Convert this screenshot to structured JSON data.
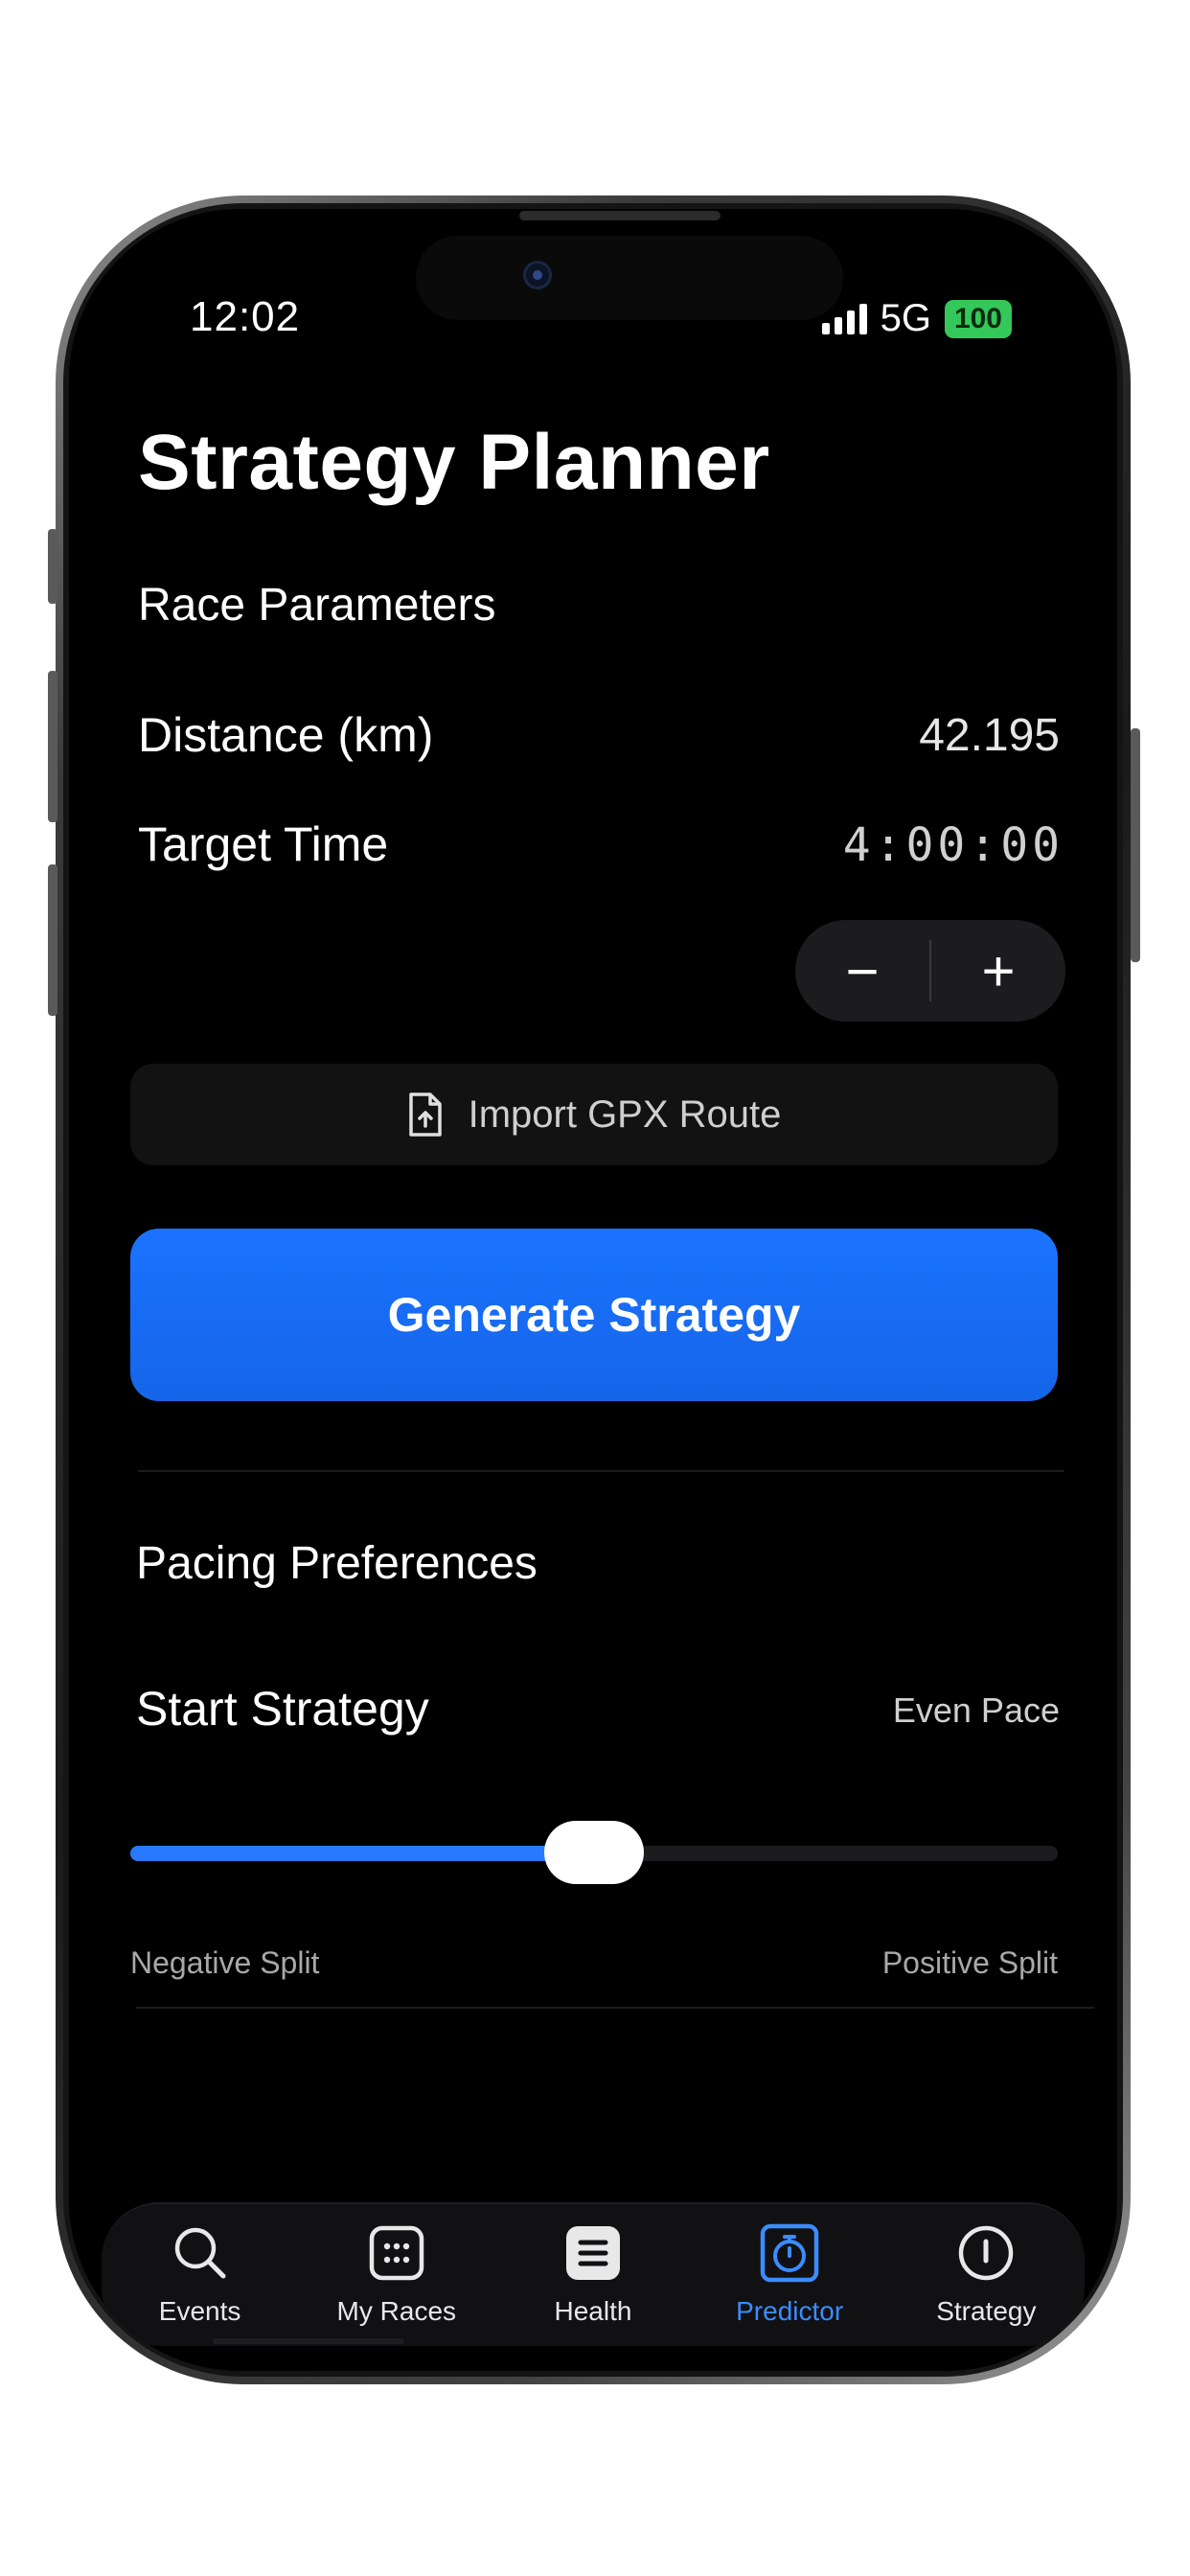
{
  "status_bar": {
    "time": "12:02",
    "network": "5G",
    "battery": "100"
  },
  "header": {
    "title": "Strategy Planner"
  },
  "race_parameters": {
    "section_title": "Race Parameters",
    "distance_label": "Distance (km)",
    "distance_value": "42.195",
    "target_time_label": "Target Time",
    "target_time_value": "4:00:00",
    "stepper_minus": "−",
    "stepper_plus": "+"
  },
  "import_button": {
    "label": "Import GPX Route",
    "icon": "file-upload-icon"
  },
  "generate_button": {
    "label": "Generate Strategy"
  },
  "pacing_preferences": {
    "section_title": "Pacing Preferences",
    "start_strategy_label": "Start Strategy",
    "start_strategy_value": "Even Pace",
    "slider_value": 0.5,
    "slider_min_label": "Negative Split",
    "slider_max_label": "Positive Split"
  },
  "tab_bar": {
    "tabs": [
      {
        "label": "Events",
        "icon": "search-icon",
        "active": false
      },
      {
        "label": "My Races",
        "icon": "grid-icon",
        "active": false
      },
      {
        "label": "Health",
        "icon": "list-icon",
        "active": false
      },
      {
        "label": "Predictor",
        "icon": "stopwatch-icon",
        "active": true
      },
      {
        "label": "Strategy",
        "icon": "info-circle-icon",
        "active": false
      }
    ]
  },
  "colors": {
    "background": "#000000",
    "accent": "#1a73ff",
    "active_tab": "#3b8cff",
    "battery": "#34c759"
  }
}
